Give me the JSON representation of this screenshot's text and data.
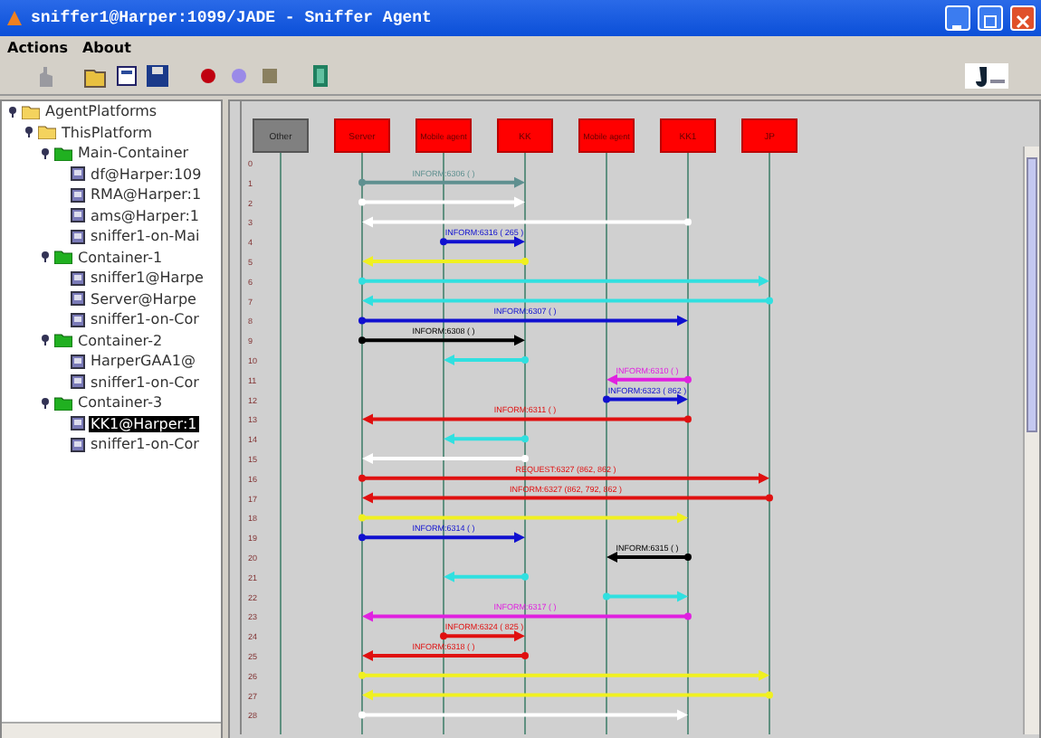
{
  "window": {
    "title": "sniffer1@Harper:1099/JADE - Sniffer Agent"
  },
  "menu": [
    "Actions",
    "About"
  ],
  "tree": [
    {
      "label": "AgentPlatforms",
      "kind": "folder",
      "expanded": true,
      "selected": false,
      "children": [
        {
          "label": "ThisPlatform",
          "kind": "folder",
          "expanded": true,
          "selected": false,
          "children": [
            {
              "label": "Main-Container",
              "kind": "container",
              "expanded": true,
              "selected": false,
              "children": [
                {
                  "label": "df@Harper:109",
                  "kind": "agent",
                  "selected": false
                },
                {
                  "label": "RMA@Harper:1",
                  "kind": "agent",
                  "selected": false
                },
                {
                  "label": "ams@Harper:1",
                  "kind": "agent",
                  "selected": false
                },
                {
                  "label": "sniffer1-on-Mai",
                  "kind": "agent",
                  "selected": false
                }
              ]
            },
            {
              "label": "Container-1",
              "kind": "container",
              "expanded": true,
              "selected": false,
              "children": [
                {
                  "label": "sniffer1@Harpe",
                  "kind": "agent",
                  "selected": false
                },
                {
                  "label": "Server@Harpe",
                  "kind": "agent",
                  "selected": false
                },
                {
                  "label": "sniffer1-on-Cor",
                  "kind": "agent",
                  "selected": false
                }
              ]
            },
            {
              "label": "Container-2",
              "kind": "container",
              "expanded": true,
              "selected": false,
              "children": [
                {
                  "label": "HarperGAA1@",
                  "kind": "agent",
                  "selected": false
                },
                {
                  "label": "sniffer1-on-Cor",
                  "kind": "agent",
                  "selected": false
                }
              ]
            },
            {
              "label": "Container-3",
              "kind": "container",
              "expanded": true,
              "selected": false,
              "children": [
                {
                  "label": "KK1@Harper:1",
                  "kind": "agent",
                  "selected": true
                },
                {
                  "label": "sniffer1-on-Cor",
                  "kind": "agent",
                  "selected": false
                }
              ]
            }
          ]
        }
      ]
    }
  ],
  "agents": [
    {
      "label": "Other",
      "kind": "other"
    },
    {
      "label": "Server",
      "kind": "agent"
    },
    {
      "label": "Mobile agent",
      "kind": "agent"
    },
    {
      "label": "KK",
      "kind": "agent"
    },
    {
      "label": "Mobile agent",
      "kind": "agent"
    },
    {
      "label": "KK1",
      "kind": "agent"
    },
    {
      "label": "JP",
      "kind": "agent"
    }
  ],
  "row_numbers": [
    "0",
    "1",
    "2",
    "3",
    "4",
    "5",
    "6",
    "7",
    "8",
    "9",
    "10",
    "11",
    "12",
    "13",
    "14",
    "15",
    "16",
    "17",
    "18",
    "19",
    "20",
    "21",
    "22",
    "23",
    "24",
    "25",
    "26",
    "27",
    "28"
  ],
  "messages": [
    {
      "color": "#5f9090",
      "label": "INFORM:6306 ( )"
    },
    {
      "color": "#ffffff"
    },
    {
      "color": "#ffffff"
    },
    {
      "color": "#1010d0",
      "label": "INFORM:6316 ( 265 )"
    },
    {
      "color": "#f0f020"
    },
    {
      "color": "#30e0e0"
    },
    {
      "color": "#30e0e0"
    },
    {
      "color": "#1010d0",
      "label": "INFORM:6307 ( )"
    },
    {
      "color": "#000000",
      "label": "INFORM:6308 ( )"
    },
    {
      "color": "#30e0e0"
    },
    {
      "color": "#e020e0",
      "label": "INFORM:6310 ( )"
    },
    {
      "color": "#1010d0",
      "label": "INFORM:6323 ( 862 )"
    },
    {
      "color": "#e01010",
      "label": "INFORM:6311 ( )"
    },
    {
      "color": "#30e0e0"
    },
    {
      "color": "#ffffff"
    },
    {
      "color": "#e01010",
      "label": "REQUEST:6327 (862, 862 )"
    },
    {
      "color": "#e01010",
      "label": "INFORM:6327 (862, 792, 862 )"
    },
    {
      "color": "#f0f020"
    },
    {
      "color": "#1010d0",
      "label": "INFORM:6314 ( )"
    },
    {
      "color": "#000000",
      "label": "INFORM:6315 ( )"
    },
    {
      "color": "#30e0e0"
    },
    {
      "color": "#30e0e0"
    },
    {
      "color": "#e020e0",
      "label": "INFORM:6317 ( )"
    },
    {
      "color": "#e01010",
      "label": "INFORM:6324 ( 825 )"
    },
    {
      "color": "#e01010",
      "label": "INFORM:6318 ( )"
    },
    {
      "color": "#f0f020"
    },
    {
      "color": "#f0f020"
    },
    {
      "color": "#ffffff"
    }
  ]
}
